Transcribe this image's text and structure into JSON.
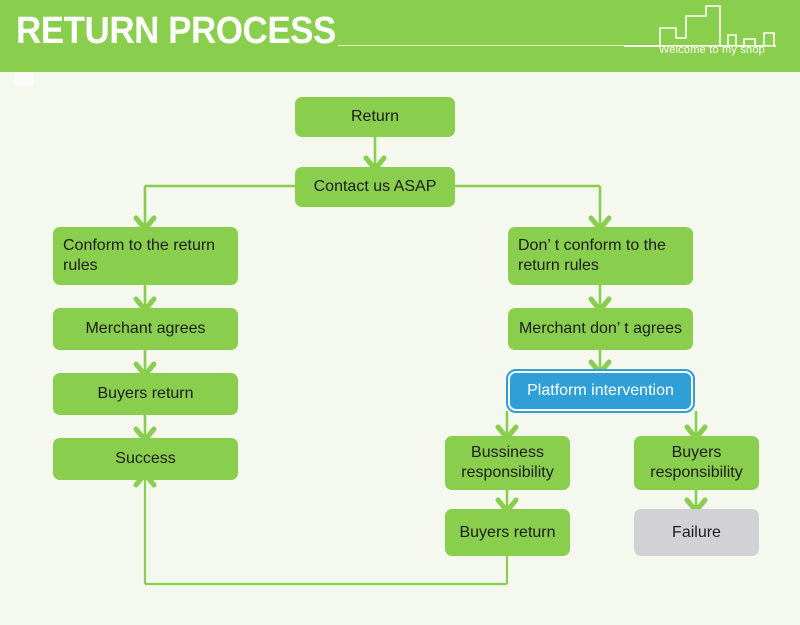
{
  "header": {
    "title": "RETURN PROCESS",
    "tagline": "Welcome to my shop",
    "bg_color": "#8ace4e",
    "text_color": "#ffffff",
    "skyline_icon": "city-skyline-outline"
  },
  "theme": {
    "page_bg": "#f5f8ee",
    "node_green": "#8ace4e",
    "node_gray": "#d2d2d6",
    "node_blue": "#2f9fd8",
    "connector": "#8ace4e",
    "node_text": "#1c1c1c"
  },
  "flowchart": {
    "nodes": [
      {
        "id": "return",
        "label": "Return",
        "style": "green",
        "align": "center"
      },
      {
        "id": "contact",
        "label": "Contact us ASAP",
        "style": "green",
        "align": "center"
      },
      {
        "id": "conform",
        "label": "Conform to the return rules",
        "style": "green",
        "align": "left"
      },
      {
        "id": "merchant-agrees",
        "label": "Merchant agrees",
        "style": "green",
        "align": "center"
      },
      {
        "id": "buyers-return-l",
        "label": "Buyers return",
        "style": "green",
        "align": "center"
      },
      {
        "id": "success",
        "label": "Success",
        "style": "green",
        "align": "center"
      },
      {
        "id": "not-conform",
        "label": "Don’ t conform to the return rules",
        "style": "green",
        "align": "left"
      },
      {
        "id": "merchant-disagree",
        "label": "Merchant don’ t agrees",
        "style": "green",
        "align": "center"
      },
      {
        "id": "platform",
        "label": "Platform intervention",
        "style": "blue",
        "align": "center"
      },
      {
        "id": "business-resp",
        "label": "Bussiness responsibility",
        "style": "green",
        "align": "center"
      },
      {
        "id": "buyers-resp",
        "label": "Buyers responsibility",
        "style": "green",
        "align": "center"
      },
      {
        "id": "buyers-return-r",
        "label": "Buyers return",
        "style": "green",
        "align": "center"
      },
      {
        "id": "failure",
        "label": "Failure",
        "style": "gray",
        "align": "center"
      }
    ],
    "edges": [
      {
        "from": "return",
        "to": "contact",
        "kind": "down-arrow"
      },
      {
        "from": "contact",
        "to": "conform",
        "kind": "split-left-down-arrow"
      },
      {
        "from": "contact",
        "to": "not-conform",
        "kind": "split-right-down-arrow"
      },
      {
        "from": "conform",
        "to": "merchant-agrees",
        "kind": "down-arrow"
      },
      {
        "from": "merchant-agrees",
        "to": "buyers-return-l",
        "kind": "down-arrow"
      },
      {
        "from": "buyers-return-l",
        "to": "success",
        "kind": "down-arrow"
      },
      {
        "from": "not-conform",
        "to": "merchant-disagree",
        "kind": "down-arrow"
      },
      {
        "from": "merchant-disagree",
        "to": "platform",
        "kind": "down-arrow"
      },
      {
        "from": "platform",
        "to": "business-resp",
        "kind": "down-arrow"
      },
      {
        "from": "platform",
        "to": "buyers-resp",
        "kind": "down-arrow"
      },
      {
        "from": "business-resp",
        "to": "buyers-return-r",
        "kind": "down-arrow"
      },
      {
        "from": "buyers-resp",
        "to": "failure",
        "kind": "down-arrow"
      },
      {
        "from": "buyers-return-r",
        "to": "success",
        "kind": "feedback-loop-up-arrow"
      }
    ]
  }
}
